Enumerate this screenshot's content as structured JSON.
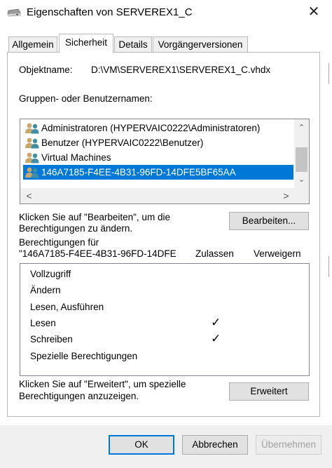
{
  "window": {
    "title": "Eigenschaften von SERVEREX1_C",
    "close_glyph": "✕"
  },
  "tabs": [
    {
      "label": "Allgemein",
      "active": false
    },
    {
      "label": "Sicherheit",
      "active": true
    },
    {
      "label": "Details",
      "active": false
    },
    {
      "label": "Vorgängerversionen",
      "active": false
    }
  ],
  "object": {
    "label": "Objektname:",
    "value": "D:\\VM\\SERVEREX1\\SERVEREX1_C.vhdx"
  },
  "groups": {
    "label": "Gruppen- oder Benutzernamen:",
    "items": [
      {
        "name": "Administratoren (HYPERVAIC0222\\Administratoren)",
        "icon": "user-group-icon",
        "selected": false
      },
      {
        "name": "Benutzer (HYPERVAIC0222\\Benutzer)",
        "icon": "user-group-icon",
        "selected": false
      },
      {
        "name": "Virtual Machines",
        "icon": "user-group-icon",
        "selected": false
      },
      {
        "name": "146A7185-F4EE-4B31-96FD-14DFE5BF65AA",
        "icon": "user-group-icon",
        "selected": true
      }
    ],
    "scroll_up": "⌃",
    "scroll_down": "⌄",
    "scroll_left": "<",
    "scroll_right": ">"
  },
  "edit": {
    "hint_line1": "Klicken Sie auf \"Bearbeiten\", um die",
    "hint_line2": "Berechtigungen zu ändern.",
    "button_label": "Bearbeiten..."
  },
  "permissions": {
    "header_line1": "Berechtigungen für",
    "header_line2": "\"146A7185-F4EE-4B31-96FD-14DFE",
    "col_allow": "Zulassen",
    "col_deny": "Verweigern",
    "rows": [
      {
        "name": "Vollzugriff",
        "allow": false,
        "deny": false
      },
      {
        "name": "Ändern",
        "allow": false,
        "deny": false
      },
      {
        "name": "Lesen, Ausführen",
        "allow": false,
        "deny": false
      },
      {
        "name": "Lesen",
        "allow": true,
        "deny": false
      },
      {
        "name": "Schreiben",
        "allow": true,
        "deny": false
      },
      {
        "name": "Spezielle Berechtigungen",
        "allow": false,
        "deny": false
      }
    ],
    "check_glyph": "✓"
  },
  "advanced": {
    "hint_line1": "Klicken Sie auf \"Erweitert\", um spezielle",
    "hint_line2": "Berechtigungen anzuzeigen.",
    "button_label": "Erweitert"
  },
  "dialog_buttons": {
    "ok": "OK",
    "cancel": "Abbrechen",
    "apply": "Übernehmen"
  },
  "colors": {
    "selection": "#0078d7",
    "button_face": "#e1e1e1",
    "user_icon_tan": "#c9a66b",
    "user_icon_teal": "#3d8fa8"
  }
}
